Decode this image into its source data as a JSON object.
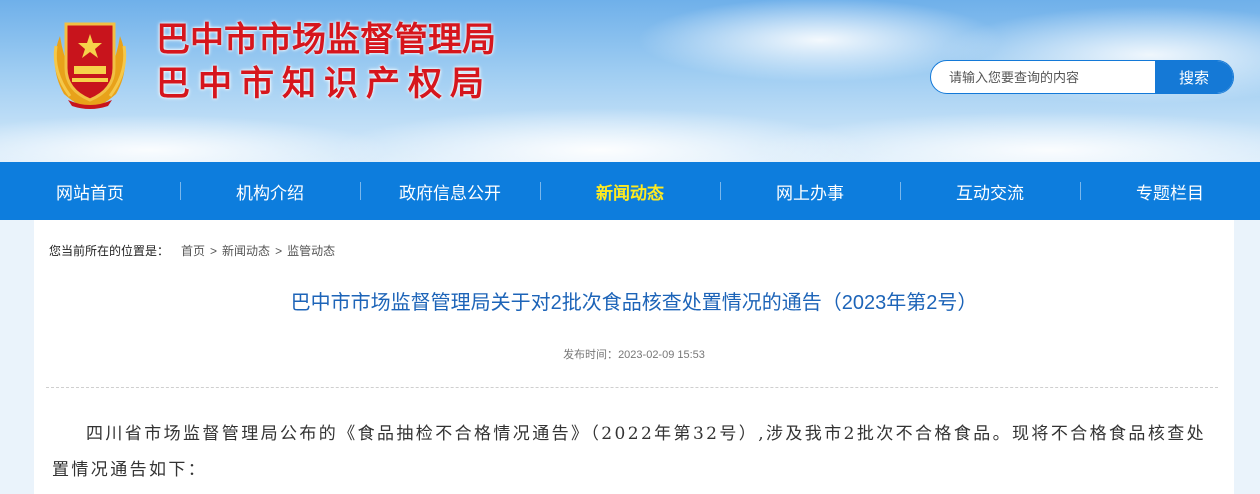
{
  "header": {
    "title_line1": "巴中市市场监督管理局",
    "title_line2": "巴中市知识产权局",
    "emblem_label": "市场监督管理"
  },
  "search": {
    "placeholder": "请输入您要查询的内容",
    "button_label": "搜索"
  },
  "nav": {
    "items": [
      {
        "label": "网站首页"
      },
      {
        "label": "机构介绍"
      },
      {
        "label": "政府信息公开"
      },
      {
        "label": "新闻动态"
      },
      {
        "label": "网上办事"
      },
      {
        "label": "互动交流"
      },
      {
        "label": "专题栏目"
      }
    ],
    "active_index": 3
  },
  "breadcrumb": {
    "label": "您当前所在的位置是：",
    "items": [
      "首页",
      "新闻动态",
      "监管动态"
    ],
    "separator": ">"
  },
  "article": {
    "title": "巴中市市场监督管理局关于对2批次食品核查处置情况的通告（2023年第2号）",
    "publish_label": "发布时间：",
    "publish_time": "2023-02-09 15:53",
    "body": "四川省市场监督管理局公布的《食品抽检不合格情况通告》（2022年第32号）,涉及我市2批次不合格食品。现将不合格食品核查处置情况通告如下："
  },
  "colors": {
    "brand_red": "#d6161d",
    "nav_blue": "#0d7ddd",
    "active_yellow": "#ffea1f",
    "title_blue": "#1d64b8"
  }
}
